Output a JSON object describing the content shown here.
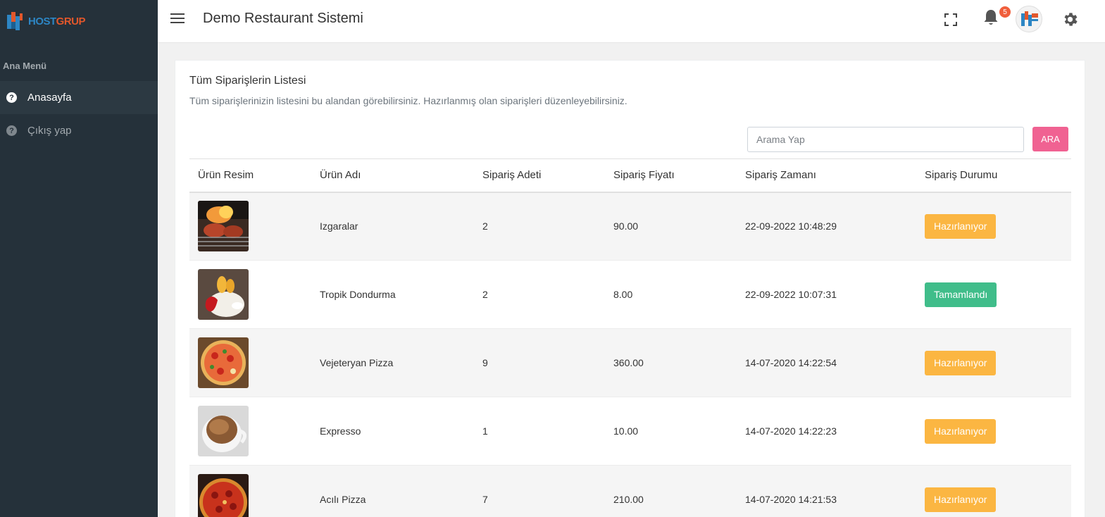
{
  "brand": {
    "logo_part1": "HOST",
    "logo_part2": "GRUP"
  },
  "sidebar": {
    "section_label": "Ana Menü",
    "items": [
      {
        "label": "Anasayfa",
        "icon": "help-circle-icon",
        "active": true
      },
      {
        "label": "Çıkış yap",
        "icon": "help-circle-icon",
        "active": false
      }
    ]
  },
  "header": {
    "title": "Demo Restaurant Sistemi",
    "notification_count": "5"
  },
  "card": {
    "title": "Tüm Siparişlerin Listesi",
    "subtitle": "Tüm siparişlerinizin listesini bu alandan görebilirsiniz. Hazırlanmış olan siparişleri düzenleyebilirsiniz.",
    "search_placeholder": "Arama Yap",
    "search_button": "ARA"
  },
  "table": {
    "columns": [
      "Ürün Resim",
      "Ürün Adı",
      "Sipariş Adeti",
      "Sipariş Fiyatı",
      "Sipariş Zamanı",
      "Sipariş Durumu"
    ],
    "rows": [
      {
        "name": "Izgaralar",
        "qty": "2",
        "price": "90.00",
        "time": "22-09-2022 10:48:29",
        "status": "Hazırlanıyor",
        "status_type": "warning"
      },
      {
        "name": "Tropik Dondurma",
        "qty": "2",
        "price": "8.00",
        "time": "22-09-2022 10:07:31",
        "status": "Tamamlandı",
        "status_type": "success"
      },
      {
        "name": "Vejeteryan Pizza",
        "qty": "9",
        "price": "360.00",
        "time": "14-07-2020 14:22:54",
        "status": "Hazırlanıyor",
        "status_type": "warning"
      },
      {
        "name": "Expresso",
        "qty": "1",
        "price": "10.00",
        "time": "14-07-2020 14:22:23",
        "status": "Hazırlanıyor",
        "status_type": "warning"
      },
      {
        "name": "Acılı Pizza",
        "qty": "7",
        "price": "210.00",
        "time": "14-07-2020 14:21:53",
        "status": "Hazırlanıyor",
        "status_type": "warning"
      }
    ]
  },
  "colors": {
    "sidebar_bg": "#25313a",
    "warning": "#fbb642",
    "success": "#40bd8a",
    "search_button": "#f06292"
  }
}
